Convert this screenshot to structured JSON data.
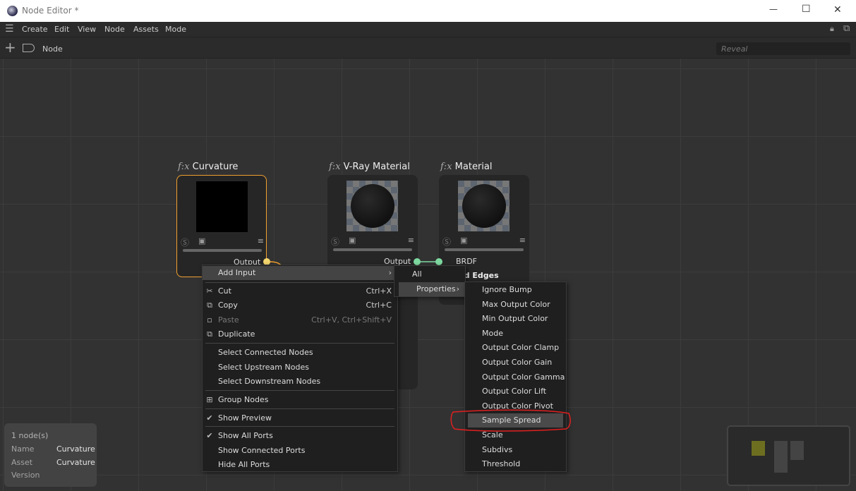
{
  "window": {
    "title": "Node Editor *",
    "minimize": "—",
    "maximize": "☐",
    "close": "✕"
  },
  "menu": [
    "Create",
    "Edit",
    "View",
    "Node",
    "Assets",
    "Mode"
  ],
  "toolbar": {
    "breadcrumb": "Node",
    "search_placeholder": "Reveal"
  },
  "nodes": [
    {
      "title": "Curvature",
      "fx": "f:x",
      "port": "Output"
    },
    {
      "title": "V-Ray Material",
      "fx": "f:x",
      "port": "Output"
    },
    {
      "title": "Material",
      "fx": "f:x",
      "port": "BRDF",
      "partial_label": "und Edges"
    }
  ],
  "context_menu": {
    "add_input": "Add Input",
    "cut": "Cut",
    "cut_sc": "Ctrl+X",
    "copy": "Copy",
    "copy_sc": "Ctrl+C",
    "paste": "Paste",
    "paste_sc": "Ctrl+V, Ctrl+Shift+V",
    "duplicate": "Duplicate",
    "select_connected": "Select Connected Nodes",
    "select_upstream": "Select Upstream Nodes",
    "select_downstream": "Select Downstream Nodes",
    "group": "Group Nodes",
    "show_preview": "Show Preview",
    "show_all_ports": "Show All Ports",
    "show_connected_ports": "Show Connected Ports",
    "hide_all_ports": "Hide All Ports"
  },
  "submenu1": {
    "all": "All",
    "properties": "Properties"
  },
  "submenu2": [
    "Ignore Bump",
    "Max Output Color",
    "Min Output Color",
    "Mode",
    "Output Color Clamp",
    "Output Color Gain",
    "Output Color Gamma",
    "Output Color Lift",
    "Output Color Pivot",
    "Sample Spread",
    "Scale",
    "Subdivs",
    "Threshold"
  ],
  "info": {
    "count": "1 node(s)",
    "name_label": "Name",
    "name": "Curvature",
    "asset_label": "Asset",
    "asset": "Curvature",
    "version_label": "Version"
  },
  "colors": {
    "selected_border": "#f0a030",
    "output_port": "#f5d76e",
    "connection": "#7ed9a0",
    "highlight_circle": "#e02020",
    "minimap_selected": "#6e6e20"
  }
}
